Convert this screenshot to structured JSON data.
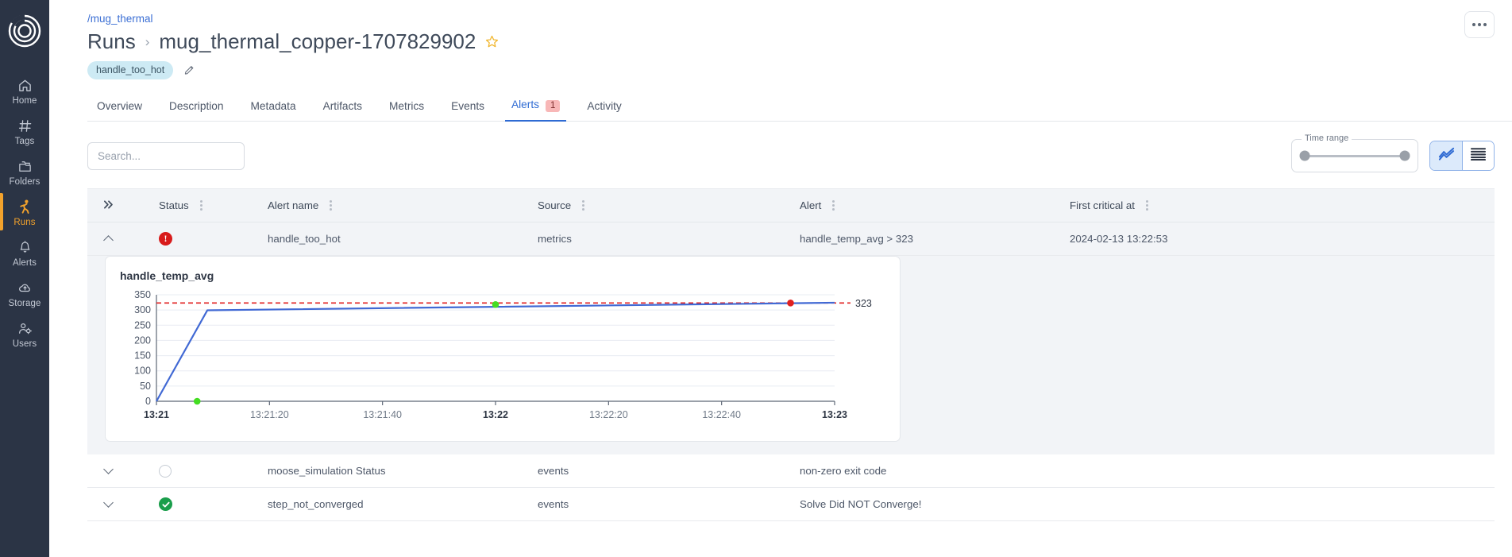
{
  "sidebar": {
    "logo_name": "app-logo",
    "items": [
      {
        "label": "Home",
        "icon": "home-icon",
        "active": false
      },
      {
        "label": "Tags",
        "icon": "hash-icon",
        "active": false
      },
      {
        "label": "Folders",
        "icon": "folder-icon",
        "active": false
      },
      {
        "label": "Runs",
        "icon": "runner-icon",
        "active": true
      },
      {
        "label": "Alerts",
        "icon": "bell-icon",
        "active": false
      },
      {
        "label": "Storage",
        "icon": "cloud-icon",
        "active": false
      },
      {
        "label": "Users",
        "icon": "users-icon",
        "active": false
      }
    ],
    "active_color": "#f2a22c",
    "background": "#2b3445"
  },
  "header": {
    "breadcrumb_path": "/mug_thermal",
    "parent": "Runs",
    "separator": "›",
    "title": "mug_thermal_copper-1707829902",
    "star_icon": "star-outline-icon",
    "tag": "handle_too_hot",
    "edit_icon": "pencil-icon",
    "more_icon": "ellipsis-icon"
  },
  "tabs": [
    {
      "label": "Overview",
      "active": false,
      "badge": null
    },
    {
      "label": "Description",
      "active": false,
      "badge": null
    },
    {
      "label": "Metadata",
      "active": false,
      "badge": null
    },
    {
      "label": "Artifacts",
      "active": false,
      "badge": null
    },
    {
      "label": "Metrics",
      "active": false,
      "badge": null
    },
    {
      "label": "Events",
      "active": false,
      "badge": null
    },
    {
      "label": "Alerts",
      "active": true,
      "badge": "1"
    },
    {
      "label": "Activity",
      "active": false,
      "badge": null
    }
  ],
  "toolbar": {
    "search_placeholder": "Search...",
    "search_value": "",
    "time_range_label": "Time range",
    "time_range_min_pct": 0,
    "time_range_max_pct": 100,
    "view_chart_icon": "line-chart-icon",
    "view_list_icon": "list-view-icon",
    "active_view": "chart"
  },
  "table": {
    "expand_all_icon": "double-chevron-right-icon",
    "columns": [
      {
        "key": "status",
        "label": "Status"
      },
      {
        "key": "alert_name",
        "label": "Alert name"
      },
      {
        "key": "source",
        "label": "Source"
      },
      {
        "key": "alert",
        "label": "Alert"
      },
      {
        "key": "first_critical_at",
        "label": "First critical at"
      }
    ],
    "rows": [
      {
        "expanded": true,
        "status": "critical",
        "status_icon": "critical-alert-icon",
        "alert_name": "handle_too_hot",
        "source": "metrics",
        "alert": "handle_temp_avg > 323",
        "first_critical_at": "2024-02-13 13:22:53"
      },
      {
        "expanded": false,
        "status": "inactive",
        "status_icon": "empty-circle-icon",
        "alert_name": "moose_simulation Status",
        "source": "events",
        "alert": "non-zero exit code",
        "first_critical_at": ""
      },
      {
        "expanded": false,
        "status": "ok",
        "status_icon": "check-circle-icon",
        "alert_name": "step_not_converged",
        "source": "events",
        "alert": "Solve Did NOT Converge!",
        "first_critical_at": ""
      }
    ]
  },
  "chart_data": {
    "type": "line",
    "title": "handle_temp_avg",
    "xlabel": "",
    "ylabel": "",
    "ylim": [
      0,
      350
    ],
    "yticks": [
      0,
      50,
      100,
      150,
      200,
      250,
      300,
      350
    ],
    "xticks": [
      "13:21",
      "13:21:20",
      "13:21:40",
      "13:22",
      "13:22:20",
      "13:22:40",
      "13:23"
    ],
    "grid": true,
    "legend": "none",
    "line_color": "#4169d4",
    "threshold": {
      "value": 323,
      "label": "323",
      "color": "#e02020",
      "style": "dashed"
    },
    "series": [
      {
        "name": "handle_temp_avg",
        "color": "#4169d4",
        "x": [
          0.0,
          7.5,
          100.0
        ],
        "values": [
          0,
          299,
          324
        ]
      }
    ],
    "markers": [
      {
        "name": "ok-marker",
        "x_pct": 6.0,
        "value": 0,
        "color": "#44dd22"
      },
      {
        "name": "ok-marker",
        "x_pct": 50.0,
        "value": 318,
        "color": "#44dd22"
      },
      {
        "name": "critical-marker",
        "x_pct": 93.5,
        "value": 323,
        "color": "#e02020"
      }
    ]
  }
}
